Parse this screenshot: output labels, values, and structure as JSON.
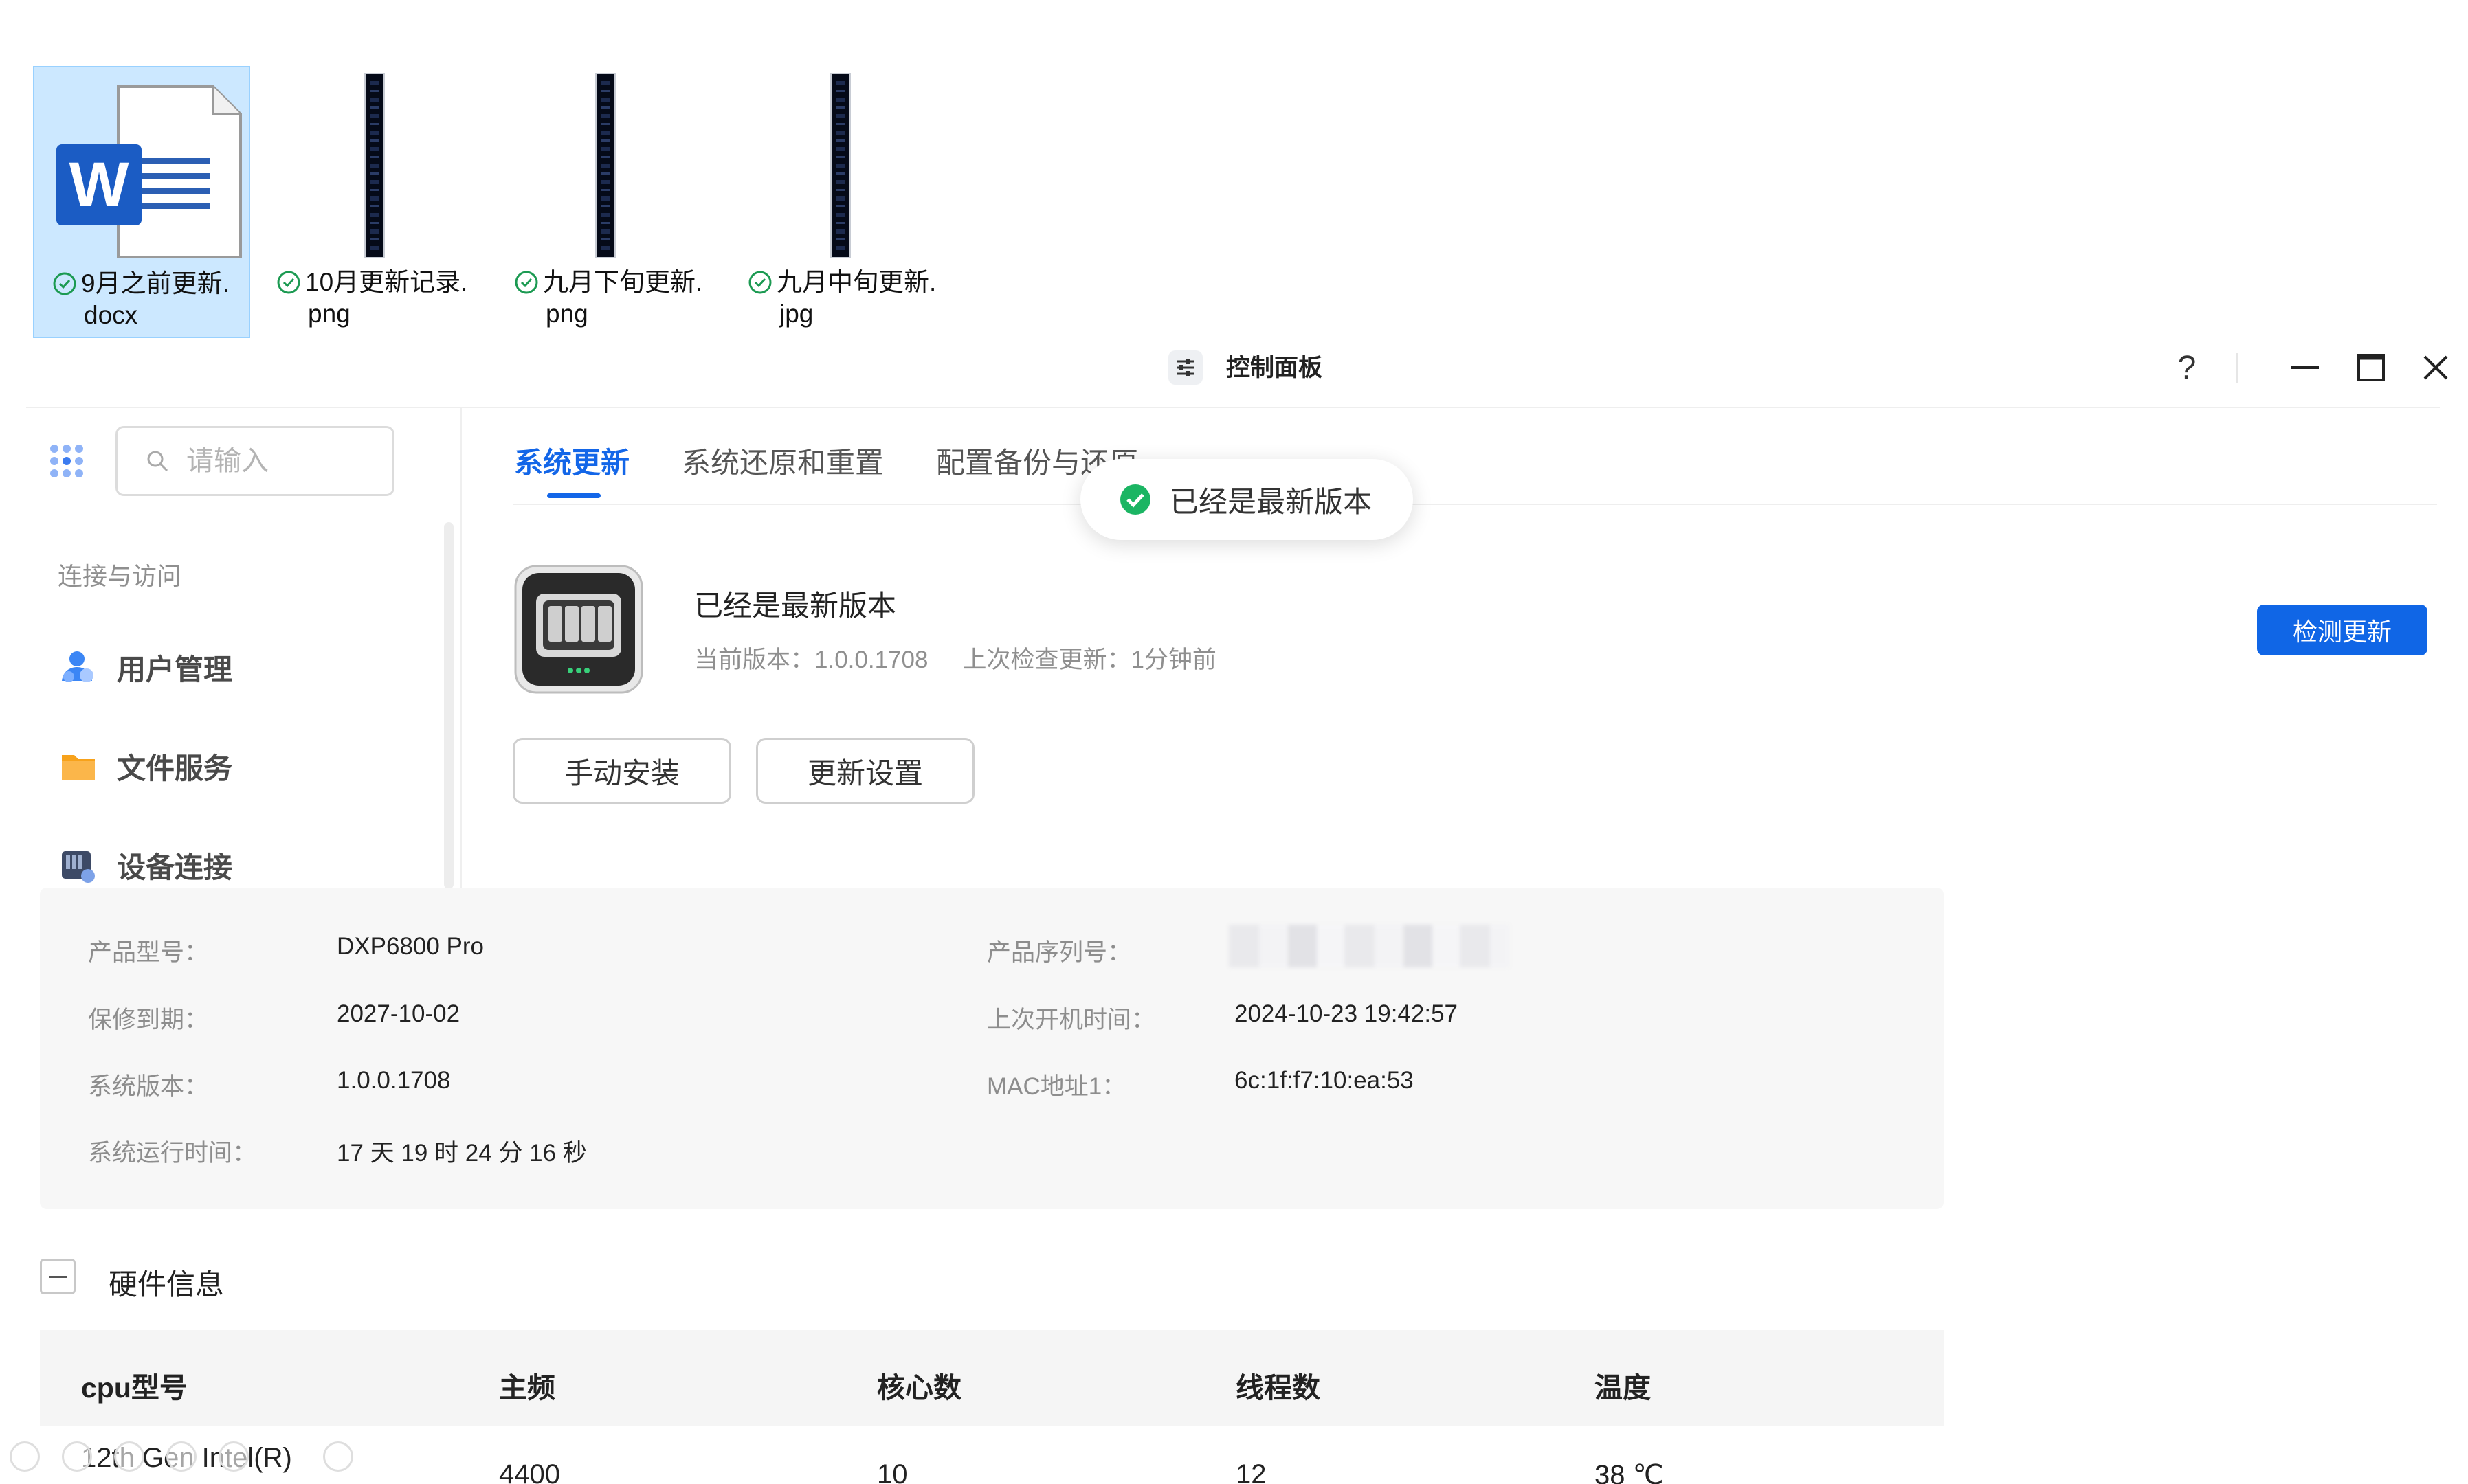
{
  "desktop": {
    "files": [
      {
        "name_line1": "9月之前更新.",
        "name_line2": "docx",
        "type": "word-document-icon",
        "selected": true
      },
      {
        "name_line1": "10月更新记录.",
        "name_line2": "png",
        "type": "image-thumbnail"
      },
      {
        "name_line1": "九月下旬更新.",
        "name_line2": "png",
        "type": "image-thumbnail"
      },
      {
        "name_line1": "九月中旬更新.",
        "name_line2": "jpg",
        "type": "image-thumbnail"
      }
    ],
    "word_letter": "W"
  },
  "window": {
    "title": "控制面板",
    "help_label": "?",
    "controls": [
      "minimize-icon",
      "maximize-icon",
      "close-icon"
    ]
  },
  "sidebar": {
    "search_placeholder": "请输入",
    "section": "连接与访问",
    "items": [
      {
        "label": "用户管理",
        "icon": "user-management-icon",
        "color": "#3b86f5"
      },
      {
        "label": "文件服务",
        "icon": "folder-icon",
        "color": "#f7a21b"
      },
      {
        "label": "设备连接",
        "icon": "device-connect-icon",
        "color": "#3d4a66"
      }
    ]
  },
  "tabs": [
    {
      "label": "系统更新",
      "active": true
    },
    {
      "label": "系统还原和重置",
      "active": false
    },
    {
      "label": "配置备份与还原",
      "active": false
    }
  ],
  "toast": {
    "text": "已经是最新版本",
    "color": "#1bb563"
  },
  "update": {
    "status": "已经是最新版本",
    "current_version_label": "当前版本：",
    "current_version": "1.0.0.1708",
    "last_check_label": "上次检查更新：",
    "last_check": "1分钟前",
    "manual_install": "手动安装",
    "update_settings": "更新设置",
    "check_update": "检测更新",
    "accent": "#1066e6"
  },
  "info": {
    "product_model_label": "产品型号：",
    "product_model": "DXP6800 Pro",
    "warranty_label": "保修到期：",
    "warranty": "2027-10-02",
    "system_version_label": "系统版本：",
    "system_version": "1.0.0.1708",
    "uptime_label": "系统运行时间：",
    "uptime": "17 天 19 时 24 分 16 秒",
    "serial_label": "产品序列号：",
    "last_boot_label": "上次开机时间：",
    "last_boot": "2024-10-23 19:42:57",
    "mac_label": "MAC地址1：",
    "mac": "6c:1f:f7:10:ea:53"
  },
  "hardware": {
    "title": "硬件信息",
    "columns": [
      "cpu型号",
      "主频",
      "核心数",
      "线程数",
      "温度"
    ],
    "row": {
      "cpu": "12th Gen Intel(R)",
      "freq": "4400",
      "cores": "10",
      "threads": "12",
      "temp": "38 ℃"
    }
  }
}
